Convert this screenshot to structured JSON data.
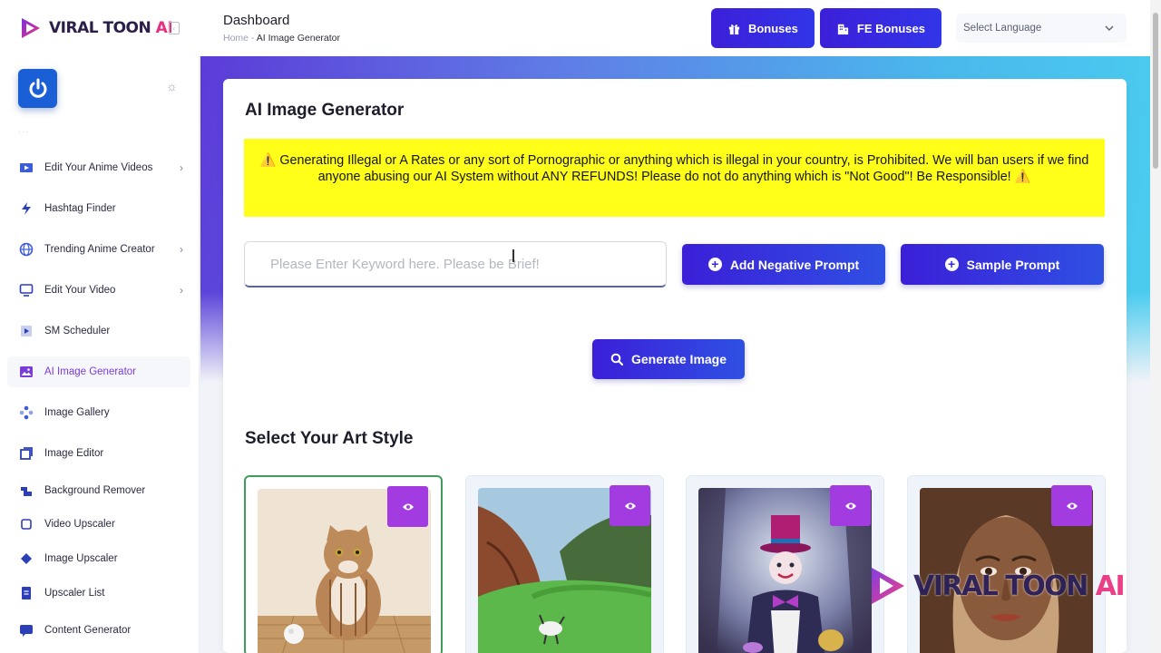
{
  "brand": {
    "name": "VIRAL TOON ",
    "suffix": "AI"
  },
  "header": {
    "title": "Dashboard",
    "breadcrumb": {
      "home": "Home",
      "separator": " - ",
      "current": "AI Image Generator"
    },
    "buttons": {
      "bonuses": "Bonuses",
      "fe_bonuses": "FE Bonuses"
    },
    "language": {
      "selected": "Select Language"
    }
  },
  "sidebar": {
    "items": [
      {
        "label": "Edit Your Anime Videos",
        "icon": "video-icon",
        "has_submenu": true
      },
      {
        "label": "Hashtag Finder",
        "icon": "bolt-icon",
        "has_submenu": false
      },
      {
        "label": "Trending Anime Creator",
        "icon": "globe-icon",
        "has_submenu": true
      },
      {
        "label": "Edit Your Video",
        "icon": "monitor-icon",
        "has_submenu": true
      },
      {
        "label": "SM Scheduler",
        "icon": "film-icon",
        "has_submenu": false
      },
      {
        "label": "AI Image Generator",
        "icon": "image-icon",
        "has_submenu": false,
        "active": true
      },
      {
        "label": "Image Gallery",
        "icon": "gallery-icon",
        "has_submenu": false
      },
      {
        "label": "Image Editor",
        "icon": "editor-icon",
        "has_submenu": false
      },
      {
        "label": "Background Remover",
        "icon": "eraser-icon",
        "has_submenu": false
      },
      {
        "label": "Video Upscaler",
        "icon": "square-icon",
        "has_submenu": false
      },
      {
        "label": "Image Upscaler",
        "icon": "diamond-icon",
        "has_submenu": false
      },
      {
        "label": "Upscaler List",
        "icon": "document-icon",
        "has_submenu": false
      },
      {
        "label": "Content Generator",
        "icon": "chat-icon",
        "has_submenu": false
      }
    ]
  },
  "main": {
    "title": "AI Image Generator",
    "warning": "⚠️ Generating Illegal or A Rates or any sort of Pornographic or anything which is illegal in your country, is Prohibited. We will ban users if we find anyone abusing our AI System without ANY REFUNDS! Please do not do anything which is \"Not Good\"! Be Responsible! ⚠️",
    "keyword_input": {
      "placeholder": "Please Enter Keyword here. Please be Brief!",
      "value": ""
    },
    "buttons": {
      "add_negative_prompt": "Add Negative Prompt",
      "sample_prompt": "Sample Prompt",
      "generate_image": "Generate Image"
    },
    "art_style_title": "Select Your Art Style",
    "art_styles": [
      {
        "image": "cat-on-floor",
        "selected": true
      },
      {
        "image": "green-valley-landscape",
        "selected": false
      },
      {
        "image": "clown-with-top-hat",
        "selected": false
      },
      {
        "image": "woman-portrait",
        "selected": false
      }
    ]
  },
  "watermark": {
    "name": "VIRAL TOON ",
    "suffix": "AI"
  },
  "colors": {
    "primary_button": "#3b1fd8",
    "accent_purple": "#a23ce0",
    "warning_bg": "#ffff1a",
    "selected_border": "#3f9d57",
    "brand_pink": "#e9307e"
  }
}
